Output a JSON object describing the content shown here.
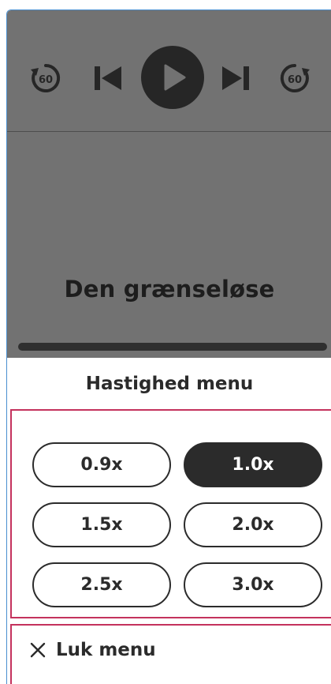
{
  "player": {
    "skip_back_seconds": "60",
    "skip_forward_seconds": "60",
    "episode_title": "Den grænseløse",
    "icons": [
      "skip-back-60-icon",
      "previous-track-icon",
      "play-icon",
      "next-track-icon",
      "skip-forward-60-icon"
    ]
  },
  "speed_menu": {
    "title": "Hastighed menu",
    "options": [
      {
        "label": "0.9x",
        "selected": false
      },
      {
        "label": "1.0x",
        "selected": true
      },
      {
        "label": "1.5x",
        "selected": false
      },
      {
        "label": "2.0x",
        "selected": false
      },
      {
        "label": "2.5x",
        "selected": false
      },
      {
        "label": "3.0x",
        "selected": false
      }
    ],
    "close_label": "Luk menu"
  },
  "colors": {
    "overlay": "#727272",
    "dark": "#2b2b2b",
    "focus_outline": "#c4325d"
  }
}
